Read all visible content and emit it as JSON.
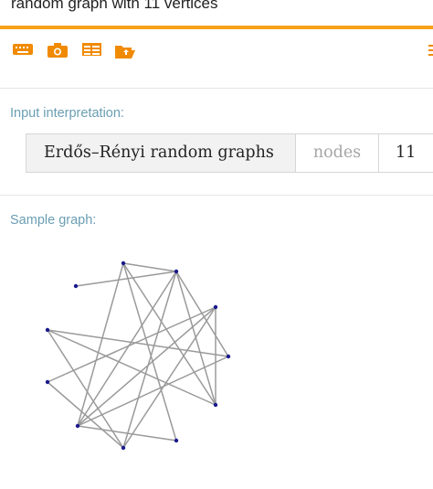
{
  "query": {
    "text": "random graph with 11 vertices"
  },
  "toolbar": {
    "icons": [
      "keyboard-icon",
      "camera-icon",
      "table-icon",
      "folder-open-icon"
    ]
  },
  "interpretation": {
    "title": "Input interpretation:",
    "name": "Erdős–Rényi random graphs",
    "param_label": "nodes",
    "param_value": "11"
  },
  "sample": {
    "title": "Sample graph:"
  },
  "colors": {
    "accent": "#f7a21b",
    "icon": "#f08a00",
    "pod_title": "#6a9eb3",
    "edge": "#9a9a9a",
    "vertex": "#1a1a8c"
  }
}
